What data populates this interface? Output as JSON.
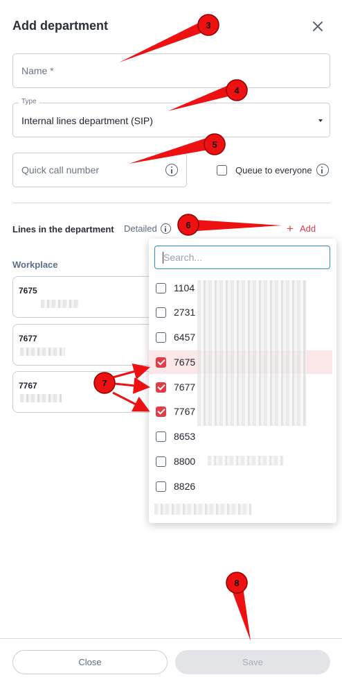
{
  "dialog": {
    "title": "Add department"
  },
  "form": {
    "name_placeholder": "Name *",
    "type_label": "Type",
    "type_value": "Internal lines department (SIP)",
    "quick_call_placeholder": "Quick call number",
    "queue_label": "Queue to everyone"
  },
  "lines": {
    "title": "Lines in the department",
    "detailed_label": "Detailed",
    "add_label": "Add",
    "workplace_label": "Workplace",
    "cards": [
      {
        "number": "7675"
      },
      {
        "number": "7677"
      },
      {
        "number": "7767"
      }
    ]
  },
  "dropdown": {
    "search_placeholder": "Search...",
    "options": [
      {
        "label": "1104",
        "checked": false
      },
      {
        "label": "2731",
        "checked": false
      },
      {
        "label": "6457",
        "checked": false
      },
      {
        "label": "7675",
        "checked": true
      },
      {
        "label": "7677",
        "checked": true
      },
      {
        "label": "7767",
        "checked": true
      },
      {
        "label": "8653",
        "checked": false
      },
      {
        "label": "8800",
        "checked": false
      },
      {
        "label": "8826",
        "checked": false
      }
    ]
  },
  "footer": {
    "close_label": "Close",
    "save_label": "Save"
  },
  "annotations": [
    "3",
    "4",
    "5",
    "6",
    "7",
    "8"
  ],
  "colors": {
    "accent": "#e23b4a",
    "annotation": "#ee1111",
    "focus": "#2d8fd0"
  }
}
